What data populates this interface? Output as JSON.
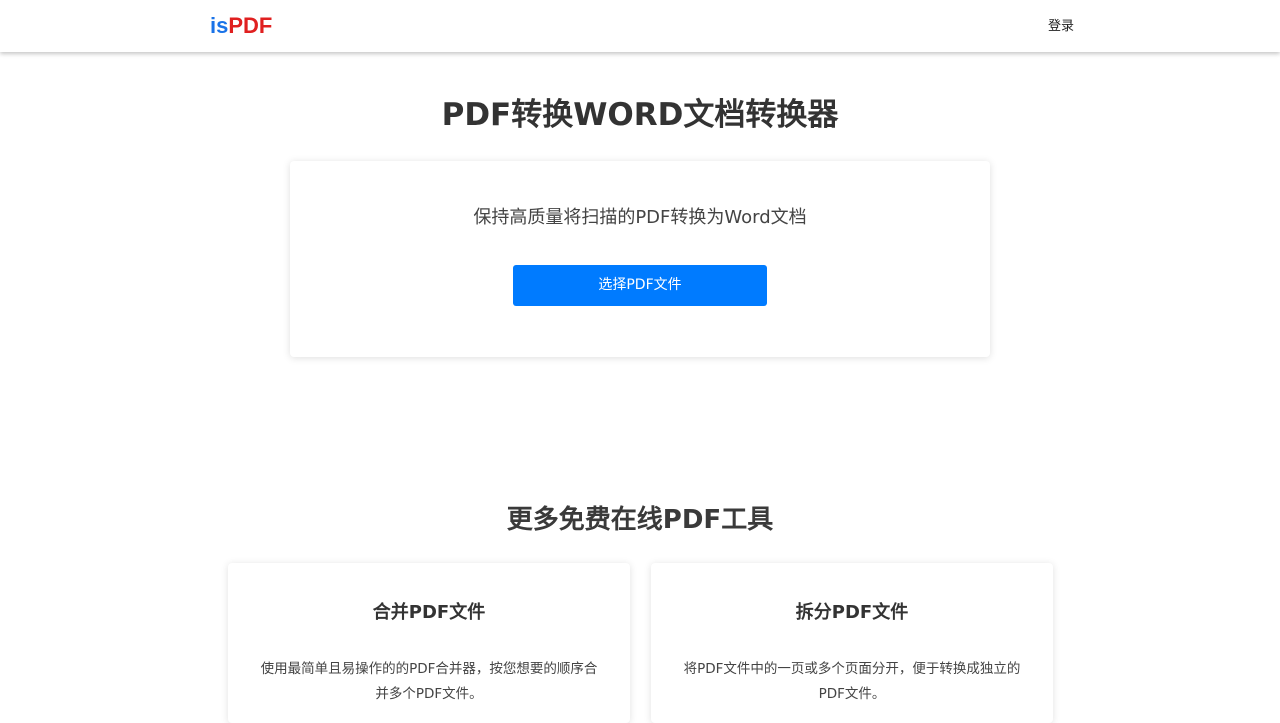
{
  "header": {
    "logo_prefix": "is",
    "logo_suffix": "PDF",
    "login_label": "登录"
  },
  "hero": {
    "title": "PDF转换WORD文档转换器",
    "subtitle": "保持高质量将扫描的PDF转换为Word文档",
    "select_button_label": "选择PDF文件"
  },
  "tools": {
    "section_title": "更多免费在线PDF工具",
    "items": [
      {
        "name": "合并PDF文件",
        "description": "使用最简单且易操作的的PDF合并器，按您想要的顺序合并多个PDF文件。"
      },
      {
        "name": "拆分PDF文件",
        "description": "将PDF文件中的一页或多个页面分开，便于转换成独立的PDF文件。"
      }
    ]
  },
  "colors": {
    "logo_is": "#1a73e8",
    "logo_pdf": "#e02020",
    "primary_button": "#007bff"
  }
}
